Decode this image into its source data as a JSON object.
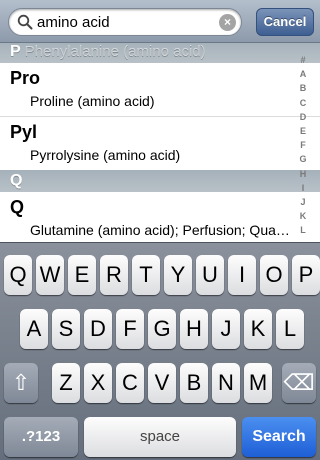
{
  "search": {
    "query": "amino acid",
    "clear_glyph": "×",
    "cancel_label": "Cancel"
  },
  "list": {
    "sections": [
      {
        "letter": "P",
        "ghost_text": "Phenylalanine (amino acid)"
      },
      {
        "letter": "Q"
      }
    ],
    "rows": [
      {
        "title": "Pro",
        "subtitle": "Proline (amino acid)"
      },
      {
        "title": "Pyl",
        "subtitle": "Pyrrolysine (amino acid)"
      },
      {
        "title": "Q",
        "subtitle": "Glutamine (amino acid); Perfusion; Qua…"
      }
    ]
  },
  "index_letters": [
    "#",
    "A",
    "B",
    "C",
    "D",
    "E",
    "F",
    "G",
    "H",
    "I",
    "J",
    "K",
    "L"
  ],
  "keyboard": {
    "row1": [
      "Q",
      "W",
      "E",
      "R",
      "T",
      "Y",
      "U",
      "I",
      "O",
      "P"
    ],
    "row2": [
      "A",
      "S",
      "D",
      "F",
      "G",
      "H",
      "J",
      "K",
      "L"
    ],
    "row3": [
      "Z",
      "X",
      "C",
      "V",
      "B",
      "N",
      "M"
    ],
    "shift_glyph": "⇧",
    "delete_glyph": "⌫",
    "numbers_label": ".?123",
    "space_label": "space",
    "search_label": "Search"
  },
  "colors": {
    "search_key": "#1e5fd6",
    "cancel_button": "#3e5f93",
    "section_header": "#a5b1ba"
  }
}
